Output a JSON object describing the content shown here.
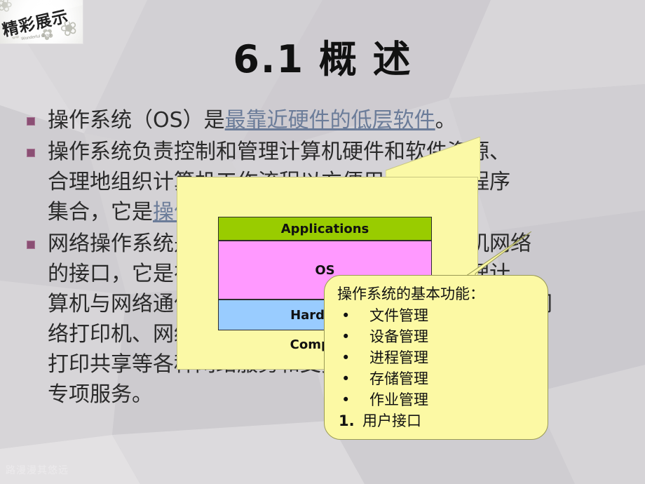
{
  "slide": {
    "logo": {
      "text": "精彩展示",
      "subtext": "Wonderful show"
    },
    "title": "6.1 概 述",
    "footer": "路漫漫其悠远",
    "bullets": [
      {
        "plain_before": "操作系统（OS）是",
        "link": "最靠近硬件的低层软件",
        "plain_after": "。",
        "lines": []
      },
      {
        "plain_before": "操作系统负责控制和管理计算机硬件和软件资源、",
        "link": "",
        "plain_after": "",
        "lines": [
          {
            "text": "合理地组织计算机工作流程以方便用户使用的程序",
            "link": ""
          },
          {
            "text": "集合，它是",
            "link": "操作系统的基本功能",
            "after": ""
          }
        ]
      },
      {
        "plain_before": "网络操作系统是用户与计算机网络之间的计算机网络",
        "link": "",
        "plain_after": "",
        "lines": [
          {
            "text": "的接口，它是在网络上实现对网络资源进行管理计",
            "link": ""
          },
          {
            "text": "算机与网络通信的软件，提供文件共享、打印共享、网",
            "link": ""
          },
          {
            "text": "络打印机、网络数据库、网络安全管理、共享、",
            "link": ""
          },
          {
            "text": "打印共享等各种网络服务和支持WWW等",
            "link": ""
          },
          {
            "text": "专项服务。",
            "link": ""
          }
        ]
      }
    ],
    "diagram": {
      "layers": [
        {
          "label": "Applications",
          "color": "#99cc00"
        },
        {
          "label": "OS",
          "color": "#ff99ff"
        },
        {
          "label": "Hardware",
          "color": "#99ccff"
        }
      ],
      "caption": "Computer"
    },
    "functions_callout": {
      "title": "操作系统的基本功能：",
      "items": [
        {
          "marker": "•",
          "label": "文件管理",
          "numbered": false
        },
        {
          "marker": "•",
          "label": "设备管理",
          "numbered": false
        },
        {
          "marker": "•",
          "label": "进程管理",
          "numbered": false
        },
        {
          "marker": "•",
          "label": "存储管理",
          "numbered": false
        },
        {
          "marker": "•",
          "label": "作业管理",
          "numbered": false
        },
        {
          "marker": "1.",
          "label": "用户接口",
          "numbered": true
        }
      ]
    }
  }
}
